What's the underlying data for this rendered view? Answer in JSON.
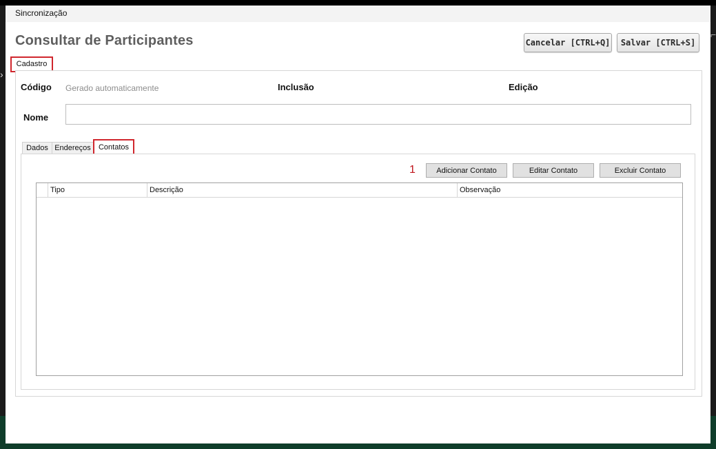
{
  "window": {
    "titlebar": "Sincronização",
    "title": "Consultar de Participantes"
  },
  "toolbar": {
    "cancel_label": "Cancelar [CTRL+Q]",
    "save_label": "Salvar [CTRL+S]"
  },
  "main_tab": {
    "label": "Cadastro"
  },
  "form": {
    "codigo_label": "Código",
    "codigo_value": "Gerado automaticamente",
    "inclusao_label": "Inclusão",
    "edicao_label": "Edição",
    "nome_label": "Nome",
    "nome_value": ""
  },
  "subtabs": [
    {
      "label": "Dados"
    },
    {
      "label": "Endereços"
    },
    {
      "label": "Contatos",
      "selected": true
    }
  ],
  "contacts": {
    "step_marker": "1",
    "add_label": "Adicionar Contato",
    "edit_label": "Editar Contato",
    "delete_label": "Excluir Contato",
    "columns": [
      "Tipo",
      "Descrição",
      "Observação"
    ],
    "rows": []
  },
  "colors": {
    "highlight": "#d0262d",
    "title": "#5e5e5e",
    "step_marker": "#c0141b"
  }
}
